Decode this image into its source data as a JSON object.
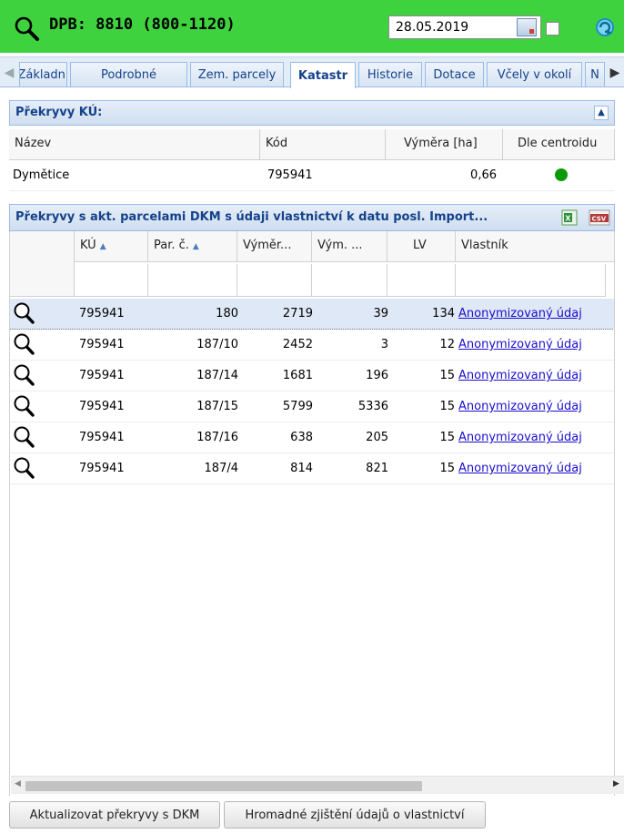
{
  "header": {
    "title": "DPB: 8810 (800-1120)",
    "date": "28.05.2019",
    "checkbox_checked": false,
    "bg_color": "#3fd23f"
  },
  "tabs": {
    "items": [
      "Základní",
      "Podrobné",
      "Zem. parcely",
      "Katastr",
      "Historie",
      "Dotace",
      "Včely v okolí",
      "N"
    ],
    "active": "Katastr"
  },
  "ku_panel": {
    "title": "Překryvy KÚ:",
    "columns": [
      "Název",
      "Kód",
      "Výměra [ha]",
      "Dle centroidu"
    ],
    "rows": [
      {
        "nazev": "Dymětice",
        "kod": "795941",
        "vymera": "0,66",
        "dle_centroidu_color": "#0a9a0a"
      }
    ]
  },
  "dkm_panel": {
    "title": "Překryvy s akt. parcelami DKM s údaji vlastnictví k datu posl. Import...",
    "export_icons": [
      "excel-icon",
      "csv-icon"
    ],
    "columns": [
      "KÚ",
      "Par. č.",
      "Výměr...",
      "Vým. ...",
      "LV",
      "Vlastník"
    ],
    "rows": [
      {
        "ku": "795941",
        "par": "180",
        "vymera": "2719",
        "vym": "39",
        "lv": "134",
        "vlastnik": "Anonymizovaný údaj"
      },
      {
        "ku": "795941",
        "par": "187/10",
        "vymera": "2452",
        "vym": "3",
        "lv": "12",
        "vlastnik": "Anonymizovaný údaj"
      },
      {
        "ku": "795941",
        "par": "187/14",
        "vymera": "1681",
        "vym": "196",
        "lv": "15",
        "vlastnik": "Anonymizovaný údaj"
      },
      {
        "ku": "795941",
        "par": "187/15",
        "vymera": "5799",
        "vym": "5336",
        "lv": "15",
        "vlastnik": "Anonymizovaný údaj"
      },
      {
        "ku": "795941",
        "par": "187/16",
        "vymera": "638",
        "vym": "205",
        "lv": "15",
        "vlastnik": "Anonymizovaný údaj"
      },
      {
        "ku": "795941",
        "par": "187/4",
        "vymera": "814",
        "vym": "821",
        "lv": "15",
        "vlastnik": "Anonymizovaný údaj"
      }
    ]
  },
  "buttons": {
    "update": "Aktualizovat překryvy s DKM",
    "bulk": "Hromadné zjištění údajů o vlastnictví"
  }
}
